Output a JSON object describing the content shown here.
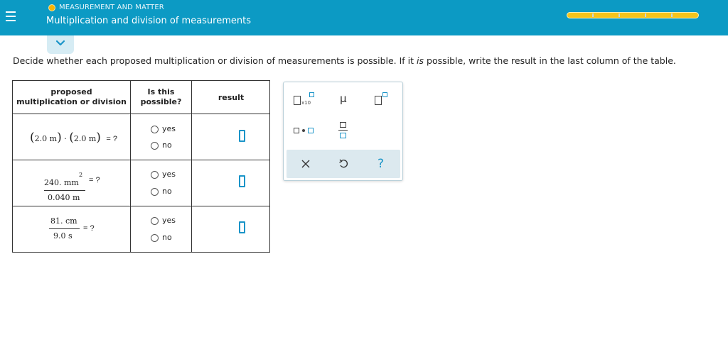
{
  "header": {
    "topic": "MEASUREMENT AND MATTER",
    "title": "Multiplication and division of measurements",
    "colors": {
      "header_bg": "#0c9ac4",
      "progress": "#f4c41c",
      "topic_dot": "#f7b500"
    },
    "progress_segments": 5,
    "progress_completed": 5
  },
  "prompt": {
    "before": "Decide whether each proposed multiplication or division of measurements is possible. If it ",
    "emphasis": "is",
    "after": " possible, write the result in the last column of the table."
  },
  "table": {
    "headers": {
      "col1_line1": "proposed",
      "col1_line2": "multiplication or division",
      "col2_line1": "Is this",
      "col2_line2": "possible?",
      "col3": "result"
    },
    "rows": [
      {
        "expr": {
          "a": "2.0 m",
          "dot": "·",
          "b": "2.0 m",
          "eq": "= ?"
        },
        "yes": "yes",
        "no": "no"
      },
      {
        "expr": {
          "num": "240. mm",
          "exp": "2",
          "den": "0.040 m",
          "eq": "= ?"
        },
        "yes": "yes",
        "no": "no"
      },
      {
        "expr": {
          "num": "81. cm",
          "den": "9.0 s",
          "eq": "= ?"
        },
        "yes": "yes",
        "no": "no"
      }
    ]
  },
  "palette": {
    "sci_label": "x10",
    "micro": "μ",
    "icons": [
      "superscript-box-icon",
      "times-ten-box-icon",
      "mu-icon",
      "multiply-dot-icon",
      "fraction-icon",
      "clear-x-icon",
      "undo-icon",
      "help-question-icon"
    ]
  }
}
